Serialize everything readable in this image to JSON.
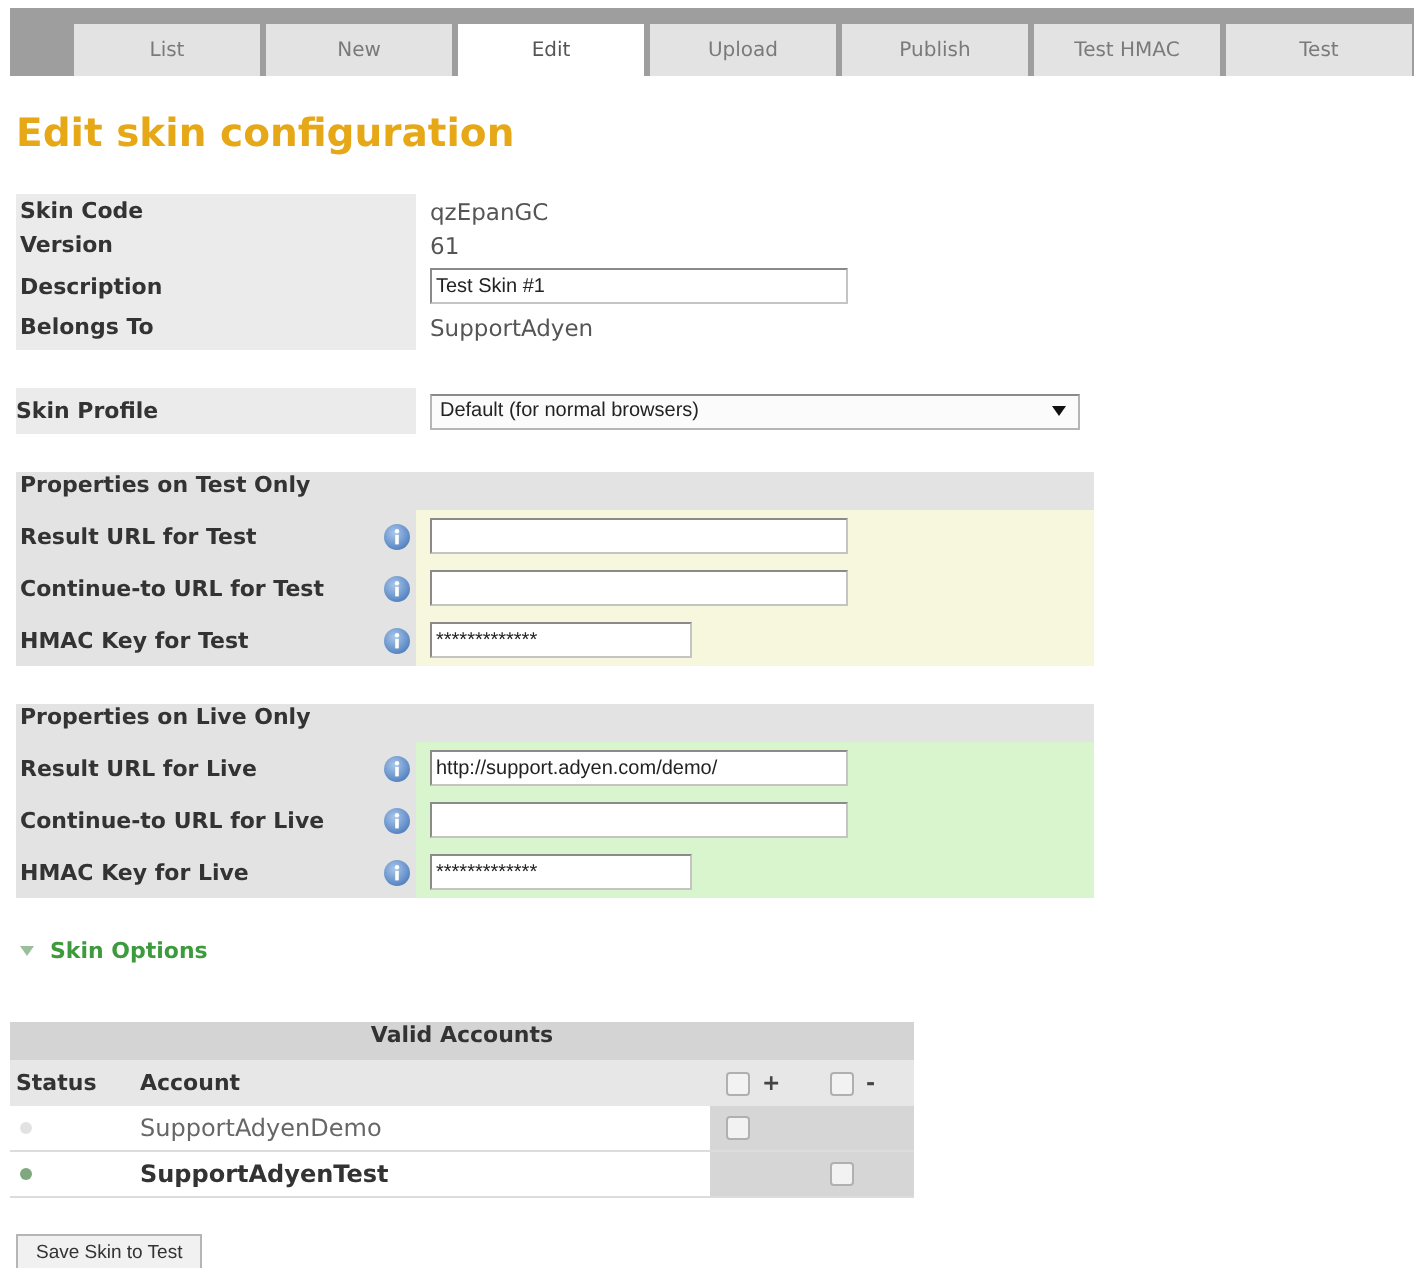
{
  "tabs": [
    {
      "label": "List",
      "selected": false
    },
    {
      "label": "New",
      "selected": false
    },
    {
      "label": "Edit",
      "selected": true
    },
    {
      "label": "Upload",
      "selected": false
    },
    {
      "label": "Publish",
      "selected": false
    },
    {
      "label": "Test HMAC",
      "selected": false
    },
    {
      "label": "Test",
      "selected": false
    }
  ],
  "title": "Edit skin configuration",
  "details": [
    {
      "label": "Skin Code",
      "value": "qzEpanGC",
      "kind": "text"
    },
    {
      "label": "Version",
      "value": "61",
      "kind": "text"
    },
    {
      "label": "Description",
      "value": "Test Skin #1",
      "kind": "input"
    },
    {
      "label": "Belongs To",
      "value": "SupportAdyen",
      "kind": "text"
    }
  ],
  "skin_profile": {
    "label": "Skin Profile",
    "value": "Default (for normal browsers)"
  },
  "sections": [
    {
      "title": "Properties on Test Only",
      "kind": "test",
      "fields": [
        {
          "label": "Result URL for Test",
          "kind": "url"
        },
        {
          "label": "Continue-to URL for Test",
          "kind": "url"
        },
        {
          "label": "HMAC Key for Test",
          "kind": "key",
          "value": "*************"
        }
      ]
    },
    {
      "title": "Properties on Live Only",
      "kind": "live",
      "fields": [
        {
          "label": "Result URL for Live",
          "kind": "url",
          "value": "http://support.adyen.com/demo/"
        },
        {
          "label": "Continue-to URL for Live",
          "kind": "url"
        },
        {
          "label": "HMAC Key for Live",
          "kind": "key",
          "value": "*************"
        }
      ]
    }
  ],
  "skin_options": {
    "label": "Skin Options"
  },
  "accounts": {
    "title": "Valid Accounts",
    "columns": [
      "Status",
      "Account"
    ],
    "header_checks": [
      {
        "label": "+",
        "checked": false
      },
      {
        "label": "-",
        "checked": false
      }
    ],
    "rows": [
      {
        "color": "#e2e2e2",
        "account": "SupportAdyenDemo",
        "active": false,
        "kind": "add",
        "checked": false
      },
      {
        "color": "#7fa87f",
        "account": "SupportAdyenTest",
        "active": true,
        "kind": "remove",
        "checked": false
      }
    ]
  },
  "save_button": "Save Skin to Test"
}
